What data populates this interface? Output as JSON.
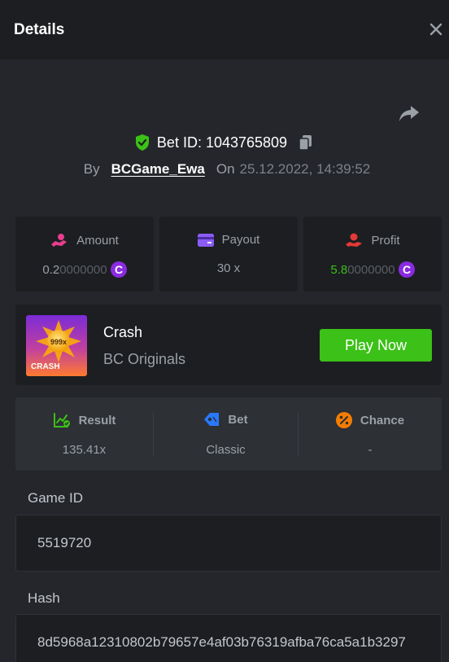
{
  "header": {
    "title": "Details"
  },
  "bet": {
    "id_label": "Bet ID: 1043765809",
    "by_label": "By",
    "user": "BCGame_Ewa",
    "on_label": "On",
    "datetime": "25.12.2022, 14:39:52"
  },
  "stats": {
    "amount": {
      "label": "Amount",
      "value_main": "0.2",
      "value_dim": "0000000"
    },
    "payout": {
      "label": "Payout",
      "value": "30 x"
    },
    "profit": {
      "label": "Profit",
      "value_main": "5.8",
      "value_dim": "0000000"
    }
  },
  "game": {
    "thumb_badge": "999x",
    "thumb_label": "CRASH",
    "name": "Crash",
    "provider": "BC Originals",
    "play_label": "Play Now"
  },
  "result": {
    "result_label": "Result",
    "result_value": "135.41x",
    "bet_label": "Bet",
    "bet_value": "Classic",
    "chance_label": "Chance",
    "chance_value": "-"
  },
  "fields": {
    "game_id_label": "Game ID",
    "game_id_value": "5519720",
    "hash_label": "Hash",
    "hash_value": "8d5968a12310802b79657e4af03b76319afba76ca5a1b3297"
  },
  "colors": {
    "accent_green": "#3bc117",
    "coin_purple": "#8a2be2",
    "amount_icon": "#e83e8c",
    "payout_icon": "#8b5cf6",
    "profit_icon": "#e53935",
    "bet_icon": "#2979ff",
    "chance_icon": "#f57c00"
  },
  "icons": {
    "close": "close-icon",
    "share": "share-icon",
    "shield": "shield-check-icon",
    "copy": "copy-icon",
    "amount": "amount-hand-icon",
    "payout": "card-icon",
    "profit": "profit-hand-icon",
    "coin": "coin-icon",
    "result": "result-chart-icon",
    "bet": "bet-tag-icon",
    "chance": "percent-icon"
  }
}
